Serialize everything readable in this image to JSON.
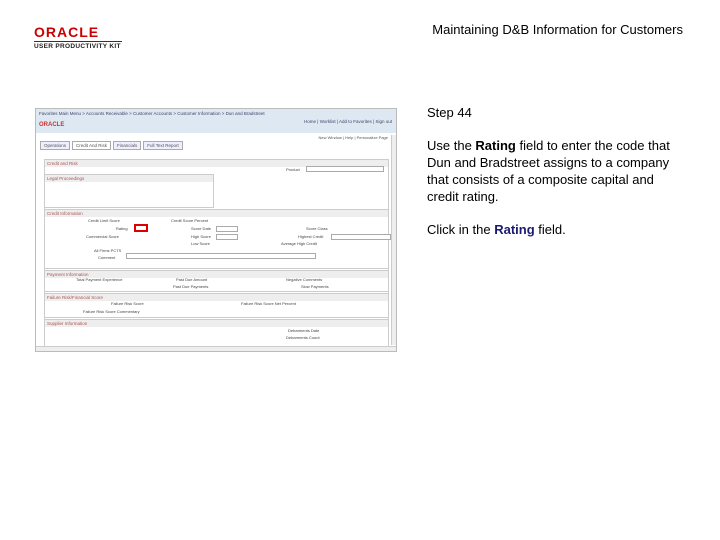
{
  "logo": {
    "brand": "ORACLE",
    "product": "USER PRODUCTIVITY KIT"
  },
  "title": "Maintaining D&B Information for Customers",
  "step": "Step 44",
  "instruction": {
    "pre": "Use the ",
    "field": "Rating",
    "post": " field to enter the code that Dun and Bradstreet assigns to a company that consists of a composite capital and credit rating."
  },
  "action": {
    "pre": "Click in the ",
    "field": "Rating",
    "post": " field."
  },
  "app": {
    "breadcrumb": "Favorites  Main Menu  > Accounts Receivable > Customer Accounts > Customer Information > Dun and Bradstreet",
    "oracle": "ORACLE",
    "links": "Home | Worklist | Add to Favorites | Sign out",
    "toplinks": "New Window | Help | Personalize Page",
    "tabs": [
      "Operations",
      "Credit And Risk",
      "Financials",
      "Full Text Report"
    ],
    "sections": [
      "Credit and Risk",
      "Legal Proceedings",
      "Credit Information",
      "Payment Information",
      "Failure Risk/Financial Score",
      "Supplier Information"
    ],
    "labels": [
      "Credit Limit Score",
      "Rating",
      "Commercial Score",
      "Score Date",
      "High Score",
      "Low Score",
      "Credit Score Percent",
      "Score Class",
      "Highest Credit",
      "Average High Credit",
      "All Firms PCTS",
      "Comment",
      "Total Payment Experience",
      "Past Due Amount",
      "Past Due Payments",
      "Negative Comments",
      "Slow Payments",
      "Failure Risk Score",
      "Failure Risk Score Commentary",
      "Failure Risk Score Net Percent",
      "Debarments Date",
      "Debarments Count",
      "Product"
    ]
  }
}
